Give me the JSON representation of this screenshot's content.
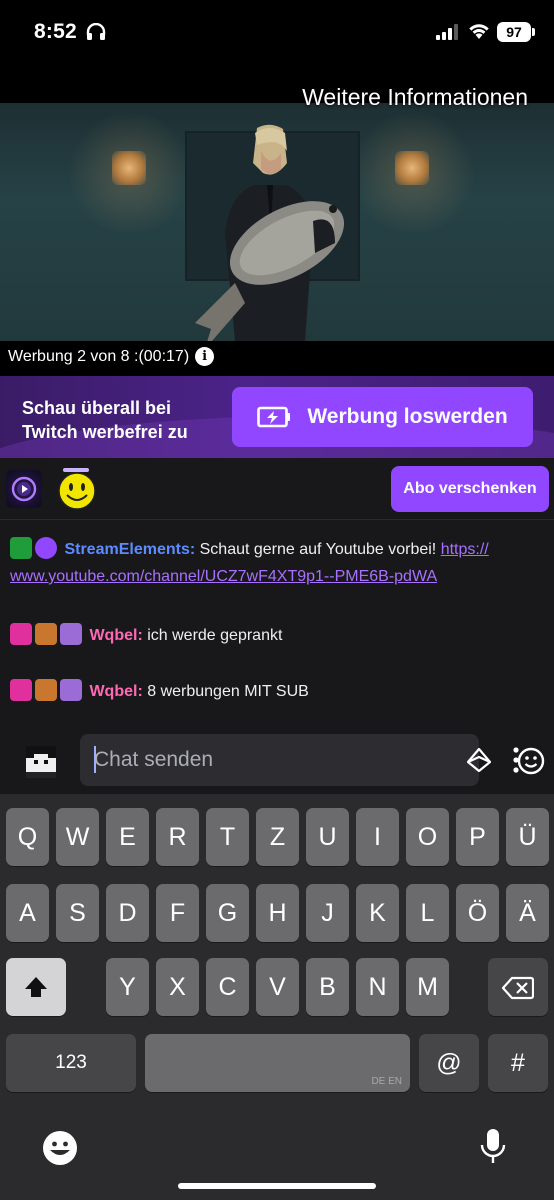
{
  "status_bar": {
    "time": "8:52",
    "battery": "97",
    "icons": [
      "headphones-icon",
      "cellular-signal-icon",
      "wifi-icon",
      "battery-icon"
    ]
  },
  "video": {
    "more_info_link": "Weitere Informationen",
    "ad_counter": "Werbung 2 von 8 :(00:17)",
    "info_icon_glyph": "i"
  },
  "promo": {
    "text_line1": "Schau überall bei",
    "text_line2": "Twitch werbefrei zu",
    "button_label": "Werbung loswerden",
    "accent_color": "#9147ff"
  },
  "hype": {
    "gift_button_label": "Abo verschenken"
  },
  "chat": {
    "messages": [
      {
        "user": "StreamElements:",
        "user_color": "#5c8cff",
        "text": " Schaut gerne auf Youtube vorbei! ",
        "link_part1": "https://",
        "link_part2": "www.youtube.com/channel/UCZ7wF4XT9p1--PME6B-pdWA"
      },
      {
        "user": "Wqbel:",
        "user_color": "#ff69b4",
        "text": " ich werde geprankt"
      },
      {
        "user": "Wqbel:",
        "user_color": "#ff69b4",
        "text": " 8 werbungen MIT SUB"
      }
    ],
    "input_placeholder": "Chat senden"
  },
  "keyboard": {
    "row1": [
      "Q",
      "W",
      "E",
      "R",
      "T",
      "Z",
      "U",
      "I",
      "O",
      "P",
      "Ü"
    ],
    "row2": [
      "A",
      "S",
      "D",
      "F",
      "G",
      "H",
      "J",
      "K",
      "L",
      "Ö",
      "Ä"
    ],
    "row3": [
      "Y",
      "X",
      "C",
      "V",
      "B",
      "N",
      "M"
    ],
    "numbers_key": "123",
    "language_label": "DE EN",
    "at_key": "@",
    "hash_key": "#"
  }
}
